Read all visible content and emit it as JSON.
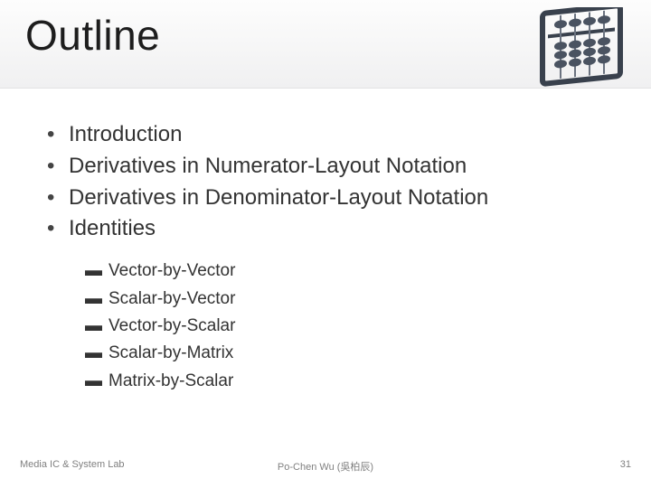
{
  "title": "Outline",
  "bullets": [
    "Introduction",
    "Derivatives in Numerator-Layout Notation",
    "Derivatives in Denominator-Layout Notation",
    "Identities"
  ],
  "sub_bullets": [
    "Vector-by-Vector",
    "Scalar-by-Vector",
    "Vector-by-Scalar",
    "Scalar-by-Matrix",
    "Matrix-by-Scalar"
  ],
  "footer": {
    "left": "Media IC & System Lab",
    "center": "Po-Chen Wu (吳柏辰)",
    "right": "31"
  }
}
